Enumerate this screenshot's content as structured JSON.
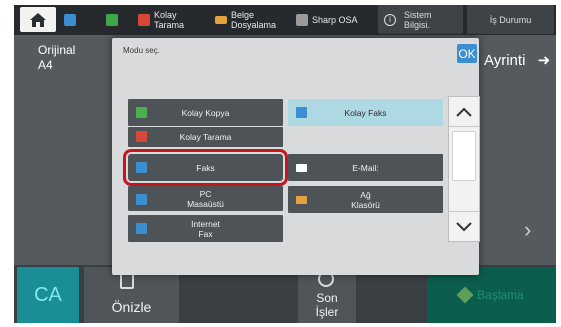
{
  "top_bar": {
    "items": [
      {
        "label": "Kolay\nTarama",
        "color": "#d9473a"
      },
      {
        "label": "Belge\nDosyalama",
        "color": "#e6a13a"
      },
      {
        "label": "Sharp OSA",
        "color": "#9a9a9a"
      }
    ],
    "system_info": "Sistem\nBilgisi.",
    "job_status": "İş Durumu"
  },
  "left_panel": {
    "label": "Orijinal",
    "value": "A4"
  },
  "right_panel": {
    "detail_label": "Ayrinti"
  },
  "modal": {
    "title": "Modu seç.",
    "ok": "OK",
    "modes": [
      {
        "label": "Kolay Kopya",
        "icon": "copy-icon",
        "color": "#4caf50"
      },
      {
        "label": "Kolay Faks",
        "icon": "fax-icon",
        "color": "#3b8ed0",
        "selected": true
      },
      {
        "label": "Kolay Tarama",
        "icon": "scan-icon",
        "color": "#d9473a"
      },
      {
        "label": "Faks",
        "icon": "fax-icon",
        "color": "#3b8ed0",
        "highlighted": true
      },
      {
        "label": "E-Mail:",
        "icon": "mail-icon",
        "color": "#ffffff"
      },
      {
        "label": "PC\nMasaüstü",
        "icon": "desktop-icon",
        "color": "#3b8ed0"
      },
      {
        "label": "Ağ\nKlasörü",
        "icon": "folder-icon",
        "color": "#e6a13a"
      },
      {
        "label": "Internet\nFax",
        "icon": "internet-fax-icon",
        "color": "#3b8ed0"
      }
    ]
  },
  "bottom_bar": {
    "ca": "CA",
    "preview": "Önizle",
    "jobs": "Son\nİşler",
    "start": "Başlama"
  }
}
